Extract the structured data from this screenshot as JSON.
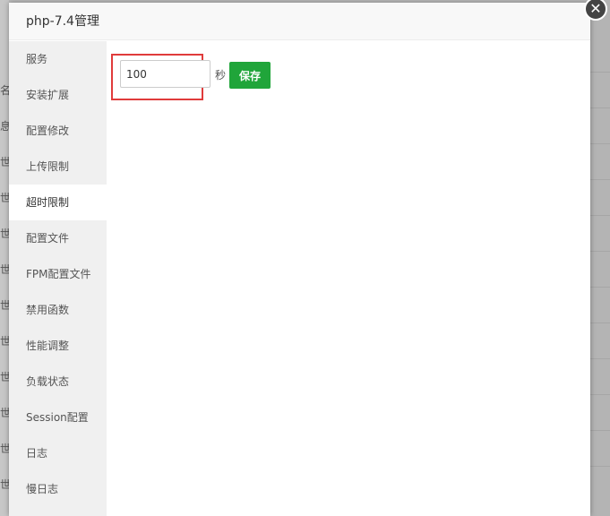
{
  "background": {
    "left_fragments": [
      "",
      "名",
      "",
      "息",
      "世",
      "世",
      "世",
      "世",
      "世",
      "世",
      "世",
      "世",
      "世",
      "世"
    ]
  },
  "dialog": {
    "title": "php-7.4管理",
    "close_icon": "✕"
  },
  "sidebar": {
    "items": [
      {
        "label": "服务",
        "active": false
      },
      {
        "label": "安装扩展",
        "active": false
      },
      {
        "label": "配置修改",
        "active": false
      },
      {
        "label": "上传限制",
        "active": false
      },
      {
        "label": "超时限制",
        "active": true
      },
      {
        "label": "配置文件",
        "active": false
      },
      {
        "label": "FPM配置文件",
        "active": false
      },
      {
        "label": "禁用函数",
        "active": false
      },
      {
        "label": "性能调整",
        "active": false
      },
      {
        "label": "负载状态",
        "active": false
      },
      {
        "label": "Session配置",
        "active": false
      },
      {
        "label": "日志",
        "active": false
      },
      {
        "label": "慢日志",
        "active": false
      }
    ]
  },
  "timeout": {
    "value": "100",
    "unit": "秒",
    "save_label": "保存"
  },
  "colors": {
    "accent": "#20a53a",
    "highlight": "#e03b3b"
  }
}
